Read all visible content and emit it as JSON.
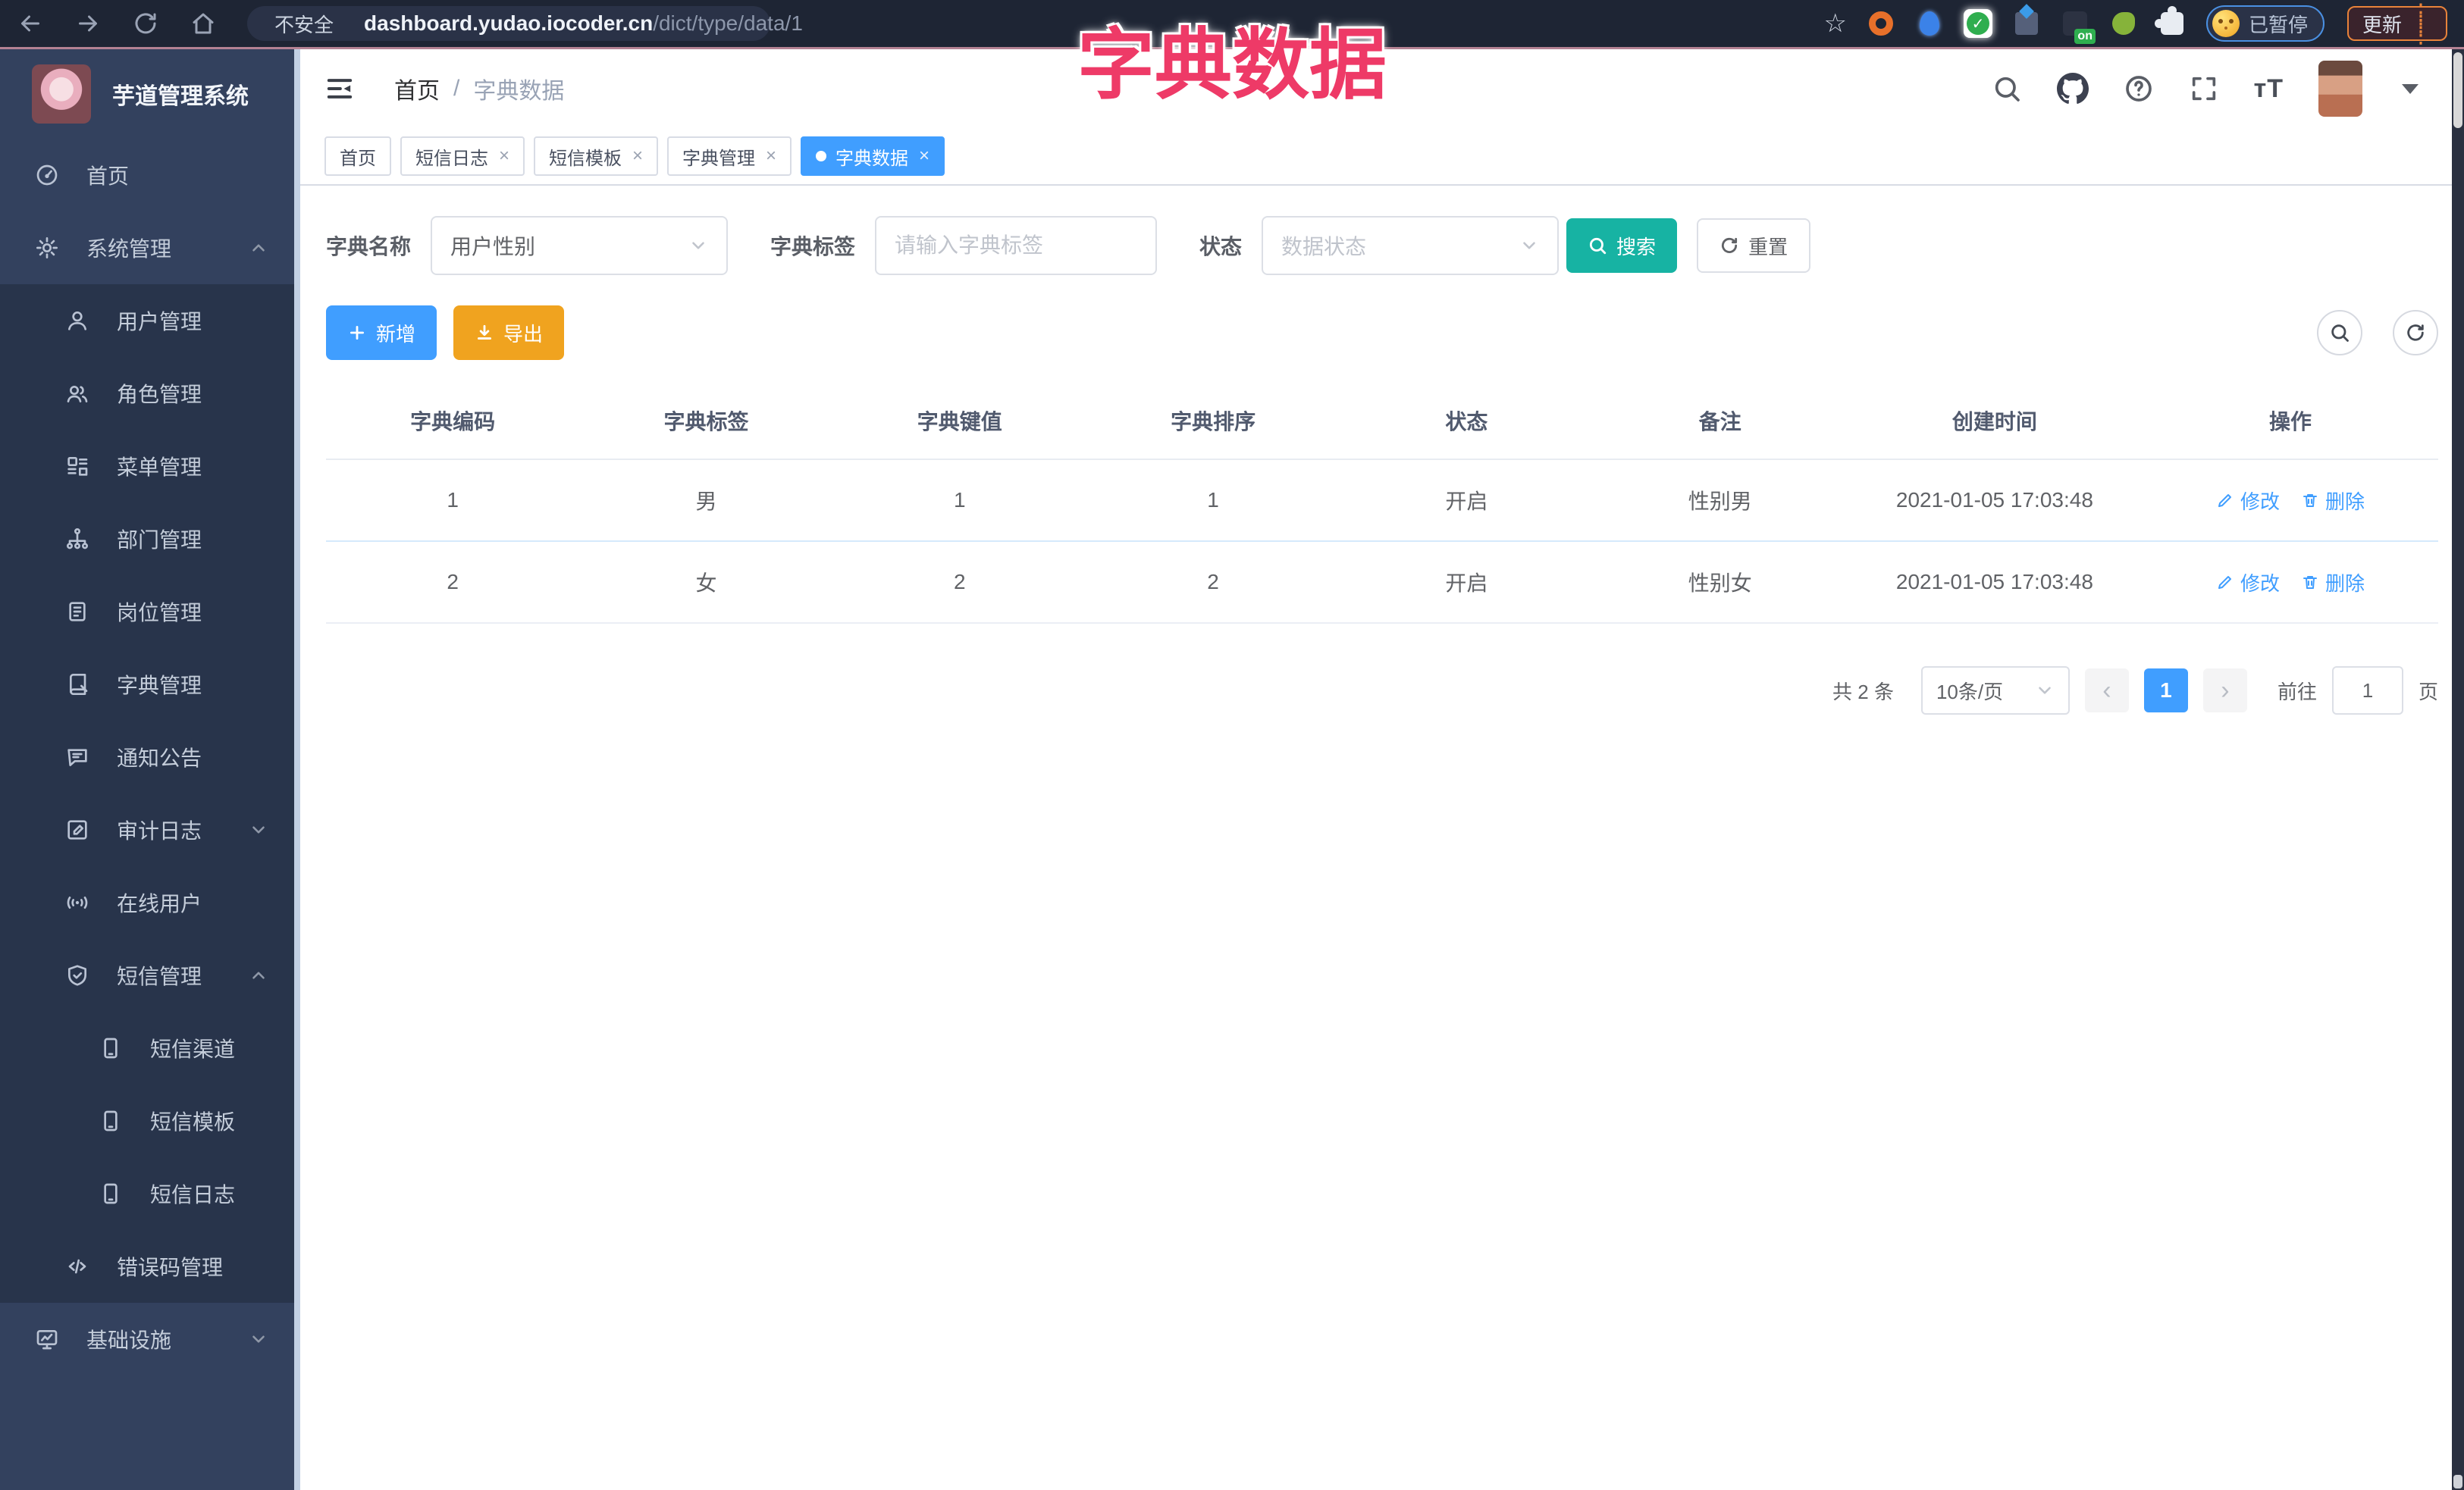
{
  "browser": {
    "security_label": "不安全",
    "url_host": "dashboard.yudao.iocoder.cn",
    "url_path": "/dict/type/data/1",
    "ext_badge": "on",
    "profile_status": "已暂停",
    "update_label": "更新"
  },
  "annotation": {
    "title": "字典数据",
    "color": "#ee3a67"
  },
  "sidebar": {
    "logo_title": "芋道管理系统",
    "items": [
      {
        "label": "首页"
      },
      {
        "label": "系统管理"
      },
      {
        "label": "用户管理"
      },
      {
        "label": "角色管理"
      },
      {
        "label": "菜单管理"
      },
      {
        "label": "部门管理"
      },
      {
        "label": "岗位管理"
      },
      {
        "label": "字典管理"
      },
      {
        "label": "通知公告"
      },
      {
        "label": "审计日志"
      },
      {
        "label": "在线用户"
      },
      {
        "label": "短信管理"
      },
      {
        "label": "短信渠道"
      },
      {
        "label": "短信模板"
      },
      {
        "label": "短信日志"
      },
      {
        "label": "错误码管理"
      },
      {
        "label": "基础设施"
      }
    ]
  },
  "breadcrumb": {
    "home": "首页",
    "sep": "/",
    "current": "字典数据"
  },
  "tabs": [
    {
      "label": "首页"
    },
    {
      "label": "短信日志"
    },
    {
      "label": "短信模板"
    },
    {
      "label": "字典管理"
    },
    {
      "label": "字典数据"
    }
  ],
  "filter": {
    "name_label": "字典名称",
    "name_value": "用户性别",
    "tag_label": "字典标签",
    "tag_placeholder": "请输入字典标签",
    "status_label": "状态",
    "status_placeholder": "数据状态",
    "search_label": "搜索",
    "reset_label": "重置"
  },
  "toolbar": {
    "add_label": "新增",
    "export_label": "导出"
  },
  "table": {
    "headers": [
      "字典编码",
      "字典标签",
      "字典键值",
      "字典排序",
      "状态",
      "备注",
      "创建时间",
      "操作"
    ],
    "rows": [
      [
        "1",
        "男",
        "1",
        "1",
        "开启",
        "性别男",
        "2021-01-05 17:03:48"
      ],
      [
        "2",
        "女",
        "2",
        "2",
        "开启",
        "性别女",
        "2021-01-05 17:03:48"
      ]
    ],
    "edit_label": "修改",
    "delete_label": "删除"
  },
  "pagination": {
    "total": "共 2 条",
    "size": "10条/页",
    "page": "1",
    "goto": "前往",
    "goto_value": "1",
    "unit": "页"
  },
  "colors": {
    "accent_blue": "#409eff",
    "teal": "#17b3a3",
    "orange": "#f0a31f",
    "sidebar": "#33415e"
  }
}
